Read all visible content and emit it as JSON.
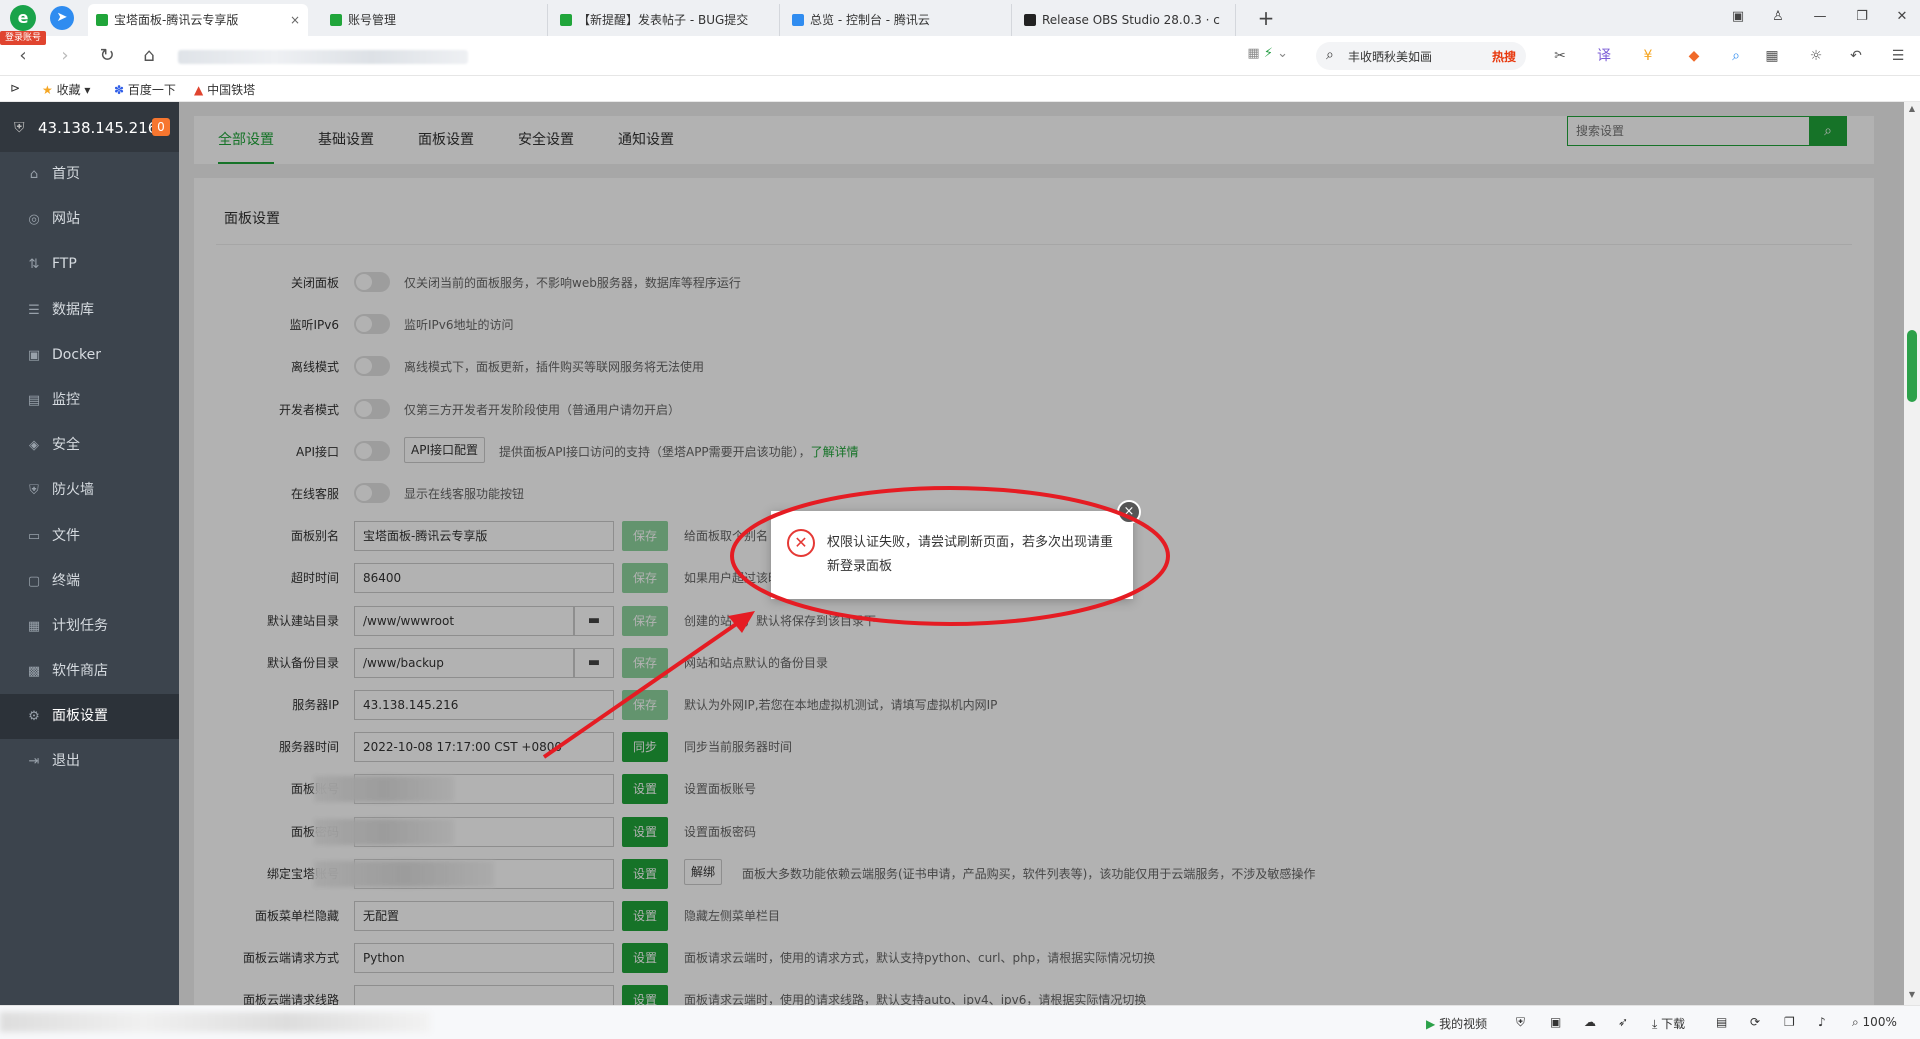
{
  "browser": {
    "logo": "e",
    "login_badge": "登录账号",
    "tabs": [
      {
        "label": "宝塔面板-腾讯云专享版",
        "color": "#20a53a",
        "active": true
      },
      {
        "label": "账号管理",
        "color": "#20a53a",
        "active": false
      },
      {
        "label": "【新提醒】发表帖子 - BUG提交",
        "color": "#20a53a",
        "active": false
      },
      {
        "label": "总览 - 控制台 - 腾讯云",
        "color": "#2f8cf0",
        "active": false
      },
      {
        "label": "Release OBS Studio 28.0.3 · c",
        "color": "#222",
        "active": false
      }
    ],
    "new_tab": "+",
    "tab_close": "×",
    "search": {
      "text": "丰收晒秋美如画",
      "hot": "热搜"
    },
    "bookmarks": [
      "收藏",
      "百度一下",
      "中国铁塔"
    ]
  },
  "sidebar": {
    "server_ip": "43.138.145.216",
    "badge": "0",
    "items": [
      {
        "label": "首页",
        "icon": "home-icon",
        "glyph": "⌂"
      },
      {
        "label": "网站",
        "icon": "globe-icon",
        "glyph": "◎"
      },
      {
        "label": "FTP",
        "icon": "ftp-icon",
        "glyph": "⇅"
      },
      {
        "label": "数据库",
        "icon": "database-icon",
        "glyph": "☰"
      },
      {
        "label": "Docker",
        "icon": "docker-icon",
        "glyph": "▣"
      },
      {
        "label": "监控",
        "icon": "monitor-icon",
        "glyph": "▤"
      },
      {
        "label": "安全",
        "icon": "shield-icon",
        "glyph": "◈"
      },
      {
        "label": "防火墙",
        "icon": "firewall-icon",
        "glyph": "⛨"
      },
      {
        "label": "文件",
        "icon": "folder-icon",
        "glyph": "▭"
      },
      {
        "label": "终端",
        "icon": "terminal-icon",
        "glyph": "▢"
      },
      {
        "label": "计划任务",
        "icon": "schedule-icon",
        "glyph": "▦"
      },
      {
        "label": "软件商店",
        "icon": "store-icon",
        "glyph": "▩"
      },
      {
        "label": "面板设置",
        "icon": "settings-icon",
        "glyph": "⚙",
        "active": true
      },
      {
        "label": "退出",
        "icon": "logout-icon",
        "glyph": "⇥"
      }
    ]
  },
  "settings": {
    "tabs": [
      "全部设置",
      "基础设置",
      "面板设置",
      "安全设置",
      "通知设置"
    ],
    "search_placeholder": "搜索设置",
    "card_title": "面板设置",
    "toggles": [
      {
        "label": "关闭面板",
        "desc": "仅关闭当前的面板服务，不影响web服务器，数据库等程序运行"
      },
      {
        "label": "监听IPv6",
        "desc": "监听IPv6地址的访问"
      },
      {
        "label": "离线模式",
        "desc": "离线模式下，面板更新，插件购买等联网服务将无法使用"
      },
      {
        "label": "开发者模式",
        "desc": "仅第三方开发者开发阶段使用（普通用户请勿开启）"
      },
      {
        "label": "API接口",
        "button": "API接口配置",
        "desc": "提供面板API接口访问的支持（堡塔APP需要开启该功能），",
        "link": "了解详情"
      },
      {
        "label": "在线客服",
        "desc": "显示在线客服功能按钮"
      }
    ],
    "fields": [
      {
        "label": "面板别名",
        "value": "宝塔面板-腾讯云专享版",
        "button": "保存",
        "desc": "给面板取个别名"
      },
      {
        "label": "超时时间",
        "value": "86400",
        "button": "保存",
        "desc": "如果用户超过该时间"
      },
      {
        "label": "默认建站目录",
        "value": "/www/wwwroot",
        "button": "保存",
        "desc": "创建的站点，默认将保存到该目录下"
      },
      {
        "label": "默认备份目录",
        "value": "/www/backup",
        "button": "保存",
        "desc": "网站和站点默认的备份目录"
      },
      {
        "label": "服务器IP",
        "value": "43.138.145.216",
        "button": "保存",
        "desc": "默认为外网IP,若您在本地虚拟机测试，请填写虚拟机内网IP"
      },
      {
        "label": "服务器时间",
        "value": "2022-10-08 17:17:00 CST +0800",
        "button": "同步",
        "desc": "同步当前服务器时间"
      },
      {
        "label": "面板账号",
        "value": "",
        "button": "设置",
        "desc": "设置面板账号"
      },
      {
        "label": "面板密码",
        "value": "",
        "button": "设置",
        "desc": "设置面板密码"
      },
      {
        "label": "绑定宝塔账号",
        "value": "",
        "button": "设置",
        "extra_button": "解绑",
        "desc": "面板大多数功能依赖云端服务(证书申请，产品购买，软件列表等)，该功能仅用于云端服务，不涉及敏感操作"
      },
      {
        "label": "面板菜单栏隐藏",
        "value": "无配置",
        "button": "设置",
        "desc": "隐藏左侧菜单栏目"
      },
      {
        "label": "面板云端请求方式",
        "value": "Python",
        "button": "设置",
        "desc": "面板请求云端时，使用的请求方式，默认支持python、curl、php，请根据实际情况切换"
      },
      {
        "label": "面板云端请求线路",
        "value": "",
        "button": "设置",
        "desc": "面板请求云端时，使用的请求线路，默认支持auto、ipv4、ipv6，请根据实际情况切换"
      }
    ]
  },
  "toast": {
    "icon": "error-icon",
    "glyph": "✕",
    "message": "权限认证失败，请尝试刷新页面，若多次出现请重新登录面板",
    "close": "×"
  },
  "statusbar": {
    "video": "我的视频",
    "download": "下载",
    "zoom": "100%"
  },
  "colors": {
    "accent": "#20a53a",
    "annotation": "#e51c23"
  }
}
